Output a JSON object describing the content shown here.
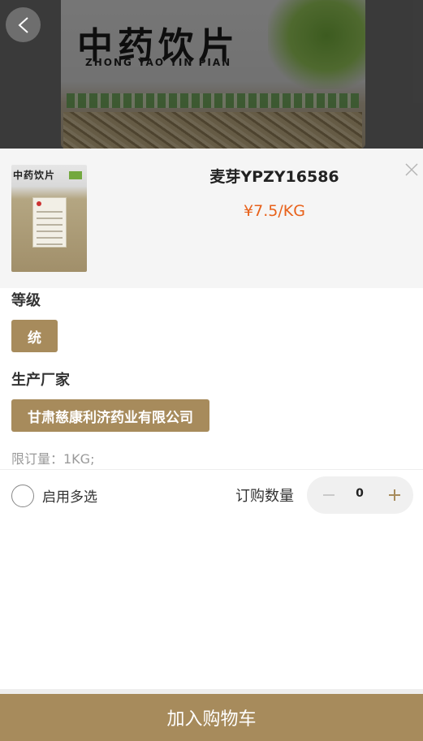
{
  "background": {
    "bag_title": "中药饮片",
    "bag_subtitle": "ZHONG YAO YIN PIAN"
  },
  "product": {
    "name": "麦芽YPZY16586",
    "price": "¥7.5/KG",
    "thumb_title": "中药饮片"
  },
  "grade": {
    "label": "等级",
    "options": [
      "统"
    ]
  },
  "manufacturer": {
    "label": "生产厂家",
    "options": [
      "甘肃慈康利济药业有限公司"
    ]
  },
  "limit_text": "限订量：1KG;",
  "multi_select": {
    "label": "启用多选",
    "checked": false
  },
  "quantity": {
    "label": "订购数量",
    "value": "0"
  },
  "cart_button": "加入购物车",
  "colors": {
    "accent": "#a78b5c",
    "price": "#e8611a"
  },
  "icons": {
    "back": "chevron-left-icon",
    "close": "close-icon",
    "minus": "minus-icon",
    "plus": "plus-icon"
  }
}
